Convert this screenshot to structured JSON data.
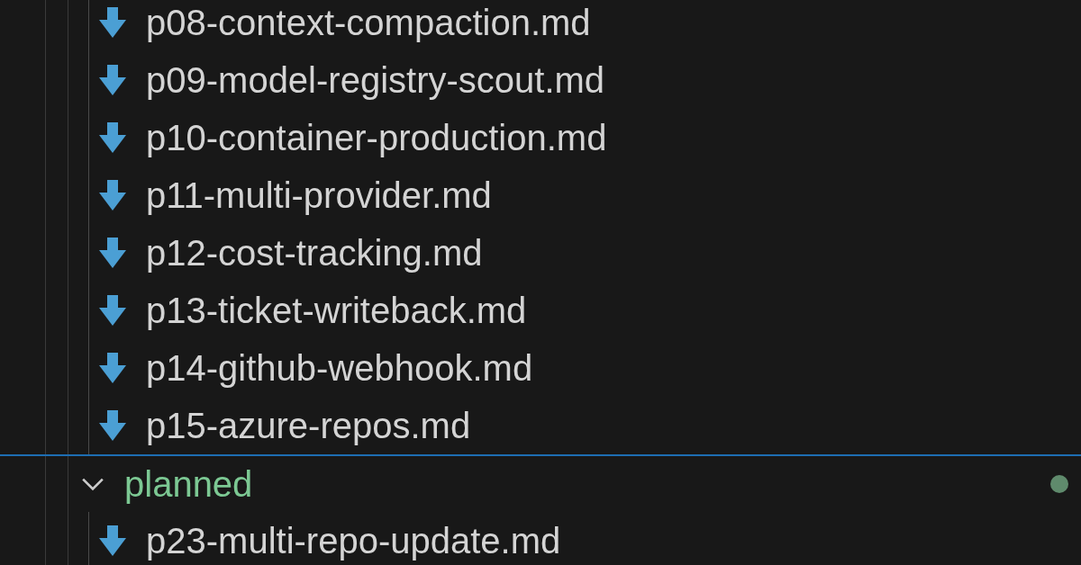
{
  "tree": [
    {
      "kind": "file",
      "name": "p08-context-compaction.md"
    },
    {
      "kind": "file",
      "name": "p09-model-registry-scout.md"
    },
    {
      "kind": "file",
      "name": "p10-container-production.md"
    },
    {
      "kind": "file",
      "name": "p11-multi-provider.md"
    },
    {
      "kind": "file",
      "name": "p12-cost-tracking.md"
    },
    {
      "kind": "file",
      "name": "p13-ticket-writeback.md"
    },
    {
      "kind": "file",
      "name": "p14-github-webhook.md"
    },
    {
      "kind": "file",
      "name": "p15-azure-repos.md"
    },
    {
      "kind": "folder",
      "name": "planned",
      "expanded": true,
      "has_changes": true,
      "children": [
        {
          "kind": "file",
          "name": "p23-multi-repo-update.md"
        }
      ]
    }
  ]
}
